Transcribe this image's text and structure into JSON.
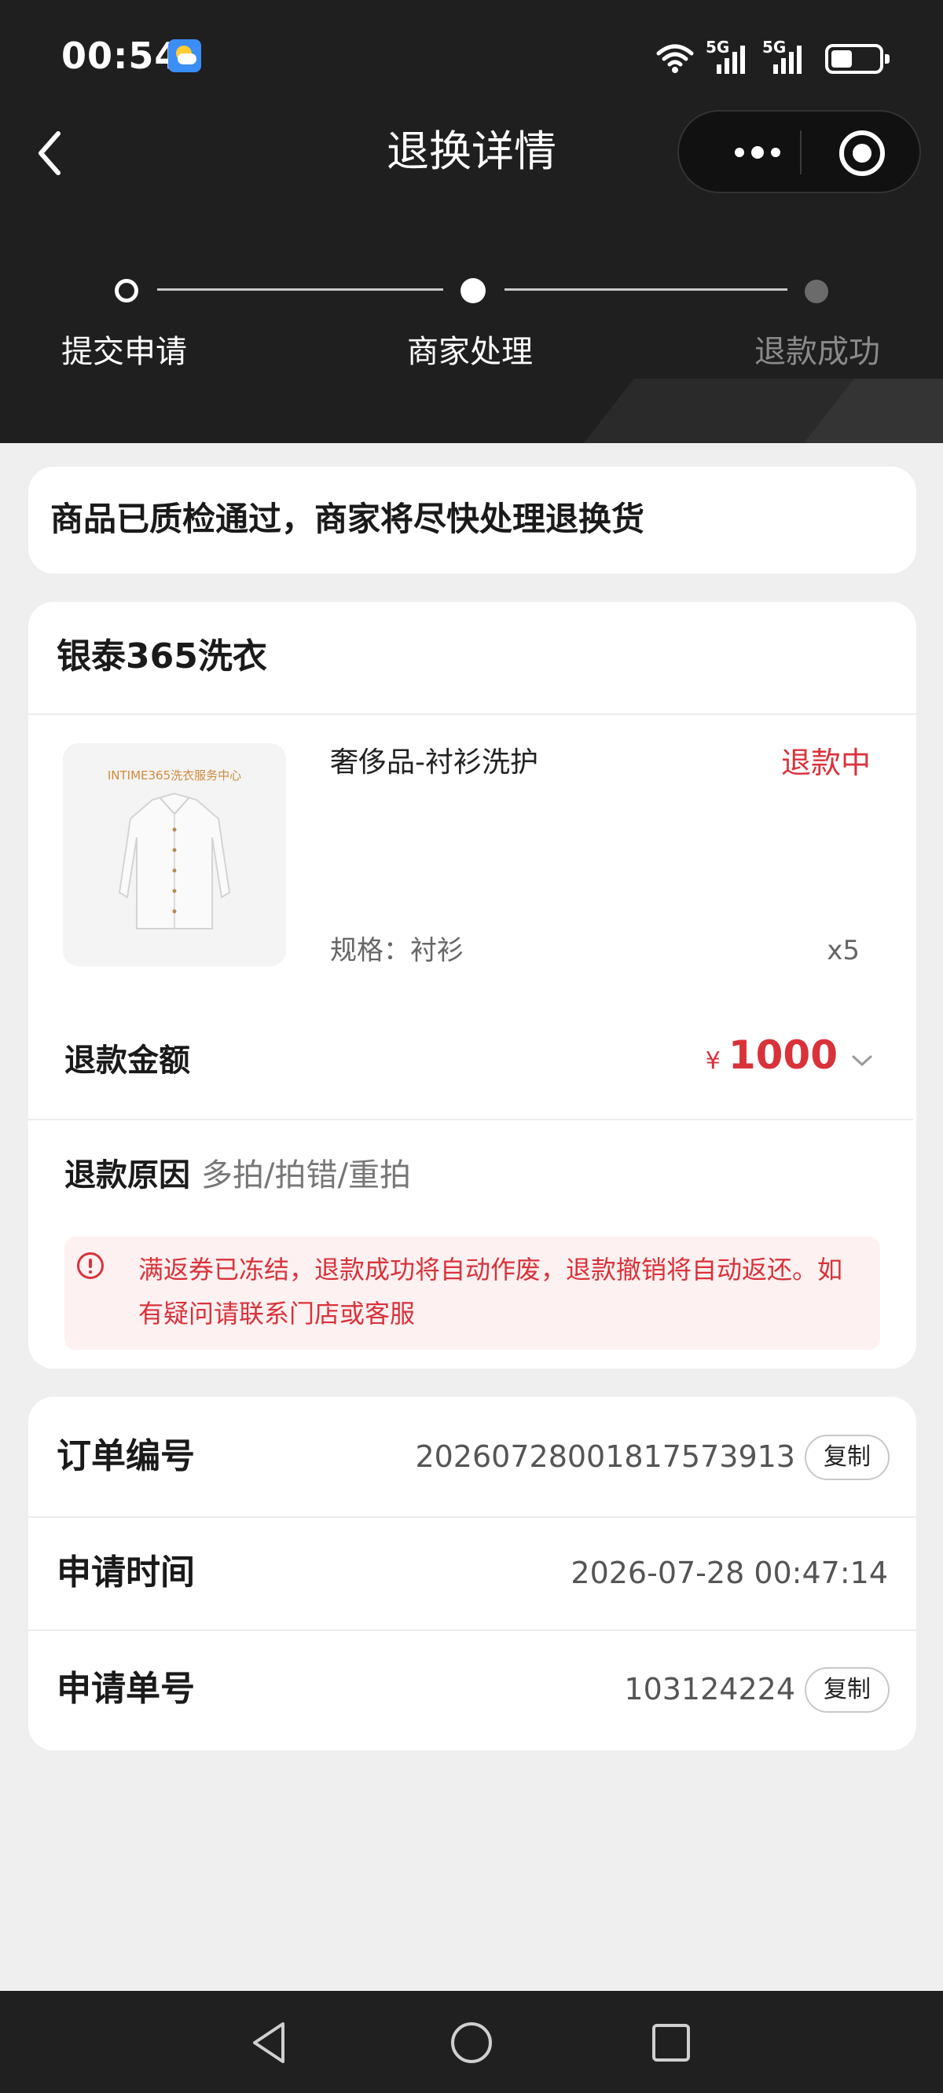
{
  "status_bar": {
    "time": "00:54",
    "network_1": "5G",
    "network_2": "5G"
  },
  "nav": {
    "title": "退换详情"
  },
  "progress": {
    "steps": [
      "提交申请",
      "商家处理",
      "退款成功"
    ],
    "current_step": 2
  },
  "notice": {
    "text": "商品已质检通过，商家将尽快处理退换货"
  },
  "order": {
    "store_name": "银泰365洗衣",
    "product": {
      "image_caption": "INTIME365洗衣服务中心",
      "name": "奢侈品-衬衫洗护",
      "status": "退款中",
      "spec": "规格：衬衫",
      "quantity": "x5"
    },
    "refund_amount": {
      "label": "退款金额",
      "currency": "¥",
      "value": "1000"
    },
    "refund_reason": {
      "label": "退款原因",
      "value": "多拍/拍错/重拍"
    },
    "warning": "满返券已冻结，退款成功将自动作废，退款撤销将自动返还。如有疑问请联系门店或客服"
  },
  "info": {
    "order_no_label": "订单编号",
    "order_no": "20260728001817573913",
    "apply_time_label": "申请时间",
    "apply_time": "2026-07-28 00:47:14",
    "apply_no_label": "申请单号",
    "apply_no": "103124224",
    "copy_label": "复制"
  },
  "colors": {
    "header_bg": "#1f1f1f",
    "accent_red": "#d9323a",
    "page_bg": "#efefef"
  }
}
